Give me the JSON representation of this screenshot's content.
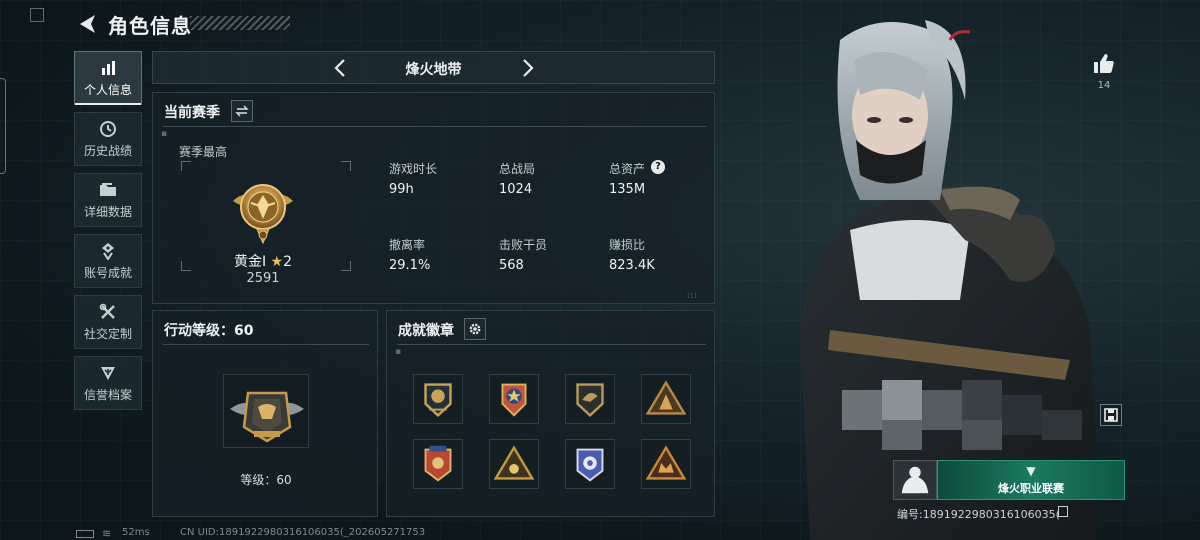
{
  "header": {
    "title": "角色信息"
  },
  "sidebar": {
    "items": [
      {
        "label": "个人信息",
        "icon": "bar-chart-icon",
        "active": true
      },
      {
        "label": "历史战绩",
        "icon": "clock-icon"
      },
      {
        "label": "详细数据",
        "icon": "folder-icon"
      },
      {
        "label": "账号成就",
        "icon": "trophy-icon"
      },
      {
        "label": "社交定制",
        "icon": "tools-icon"
      },
      {
        "label": "信誉档案",
        "icon": "shield-icon"
      }
    ]
  },
  "map_selector": {
    "name": "烽火地带"
  },
  "season": {
    "title": "当前赛季",
    "best_label": "赛季最高",
    "rank_name": "黄金I",
    "rank_stars": "2",
    "rank_score": "2591",
    "stats": [
      {
        "label": "游戏时长",
        "value": "99h"
      },
      {
        "label": "总战局",
        "value": "1024"
      },
      {
        "label": "总资产",
        "value": "135M",
        "help": "?"
      },
      {
        "label": "撤离率",
        "value": "29.1%"
      },
      {
        "label": "击败干员",
        "value": "568"
      },
      {
        "label": "赚损比",
        "value": "823.4K"
      }
    ]
  },
  "action_level": {
    "title": "行动等级：60",
    "level_text": "等级：60"
  },
  "achievements": {
    "title": "成就徽章",
    "badges": [
      {
        "name": "badge-1",
        "color": "#c9a25a"
      },
      {
        "name": "badge-2",
        "color": "#c0553a"
      },
      {
        "name": "badge-3",
        "color": "#b89a5e"
      },
      {
        "name": "badge-4",
        "color": "#b98a45"
      },
      {
        "name": "badge-5",
        "color": "#b8482f"
      },
      {
        "name": "badge-6",
        "color": "#c49a3e"
      },
      {
        "name": "badge-7",
        "color": "#4a5db0"
      },
      {
        "name": "badge-8",
        "color": "#c9883a"
      }
    ]
  },
  "right": {
    "like_count": "14",
    "uid_label": "编号:1891922980316106035(",
    "banner_text": "烽火职业联赛"
  },
  "footer": {
    "ping": "52ms",
    "cn_uid": "CN UID:1891922980316106035(_202605271753"
  },
  "colors": {
    "accent": "#e8eef0",
    "gold": "#c9a25a",
    "panel": "#162126"
  }
}
